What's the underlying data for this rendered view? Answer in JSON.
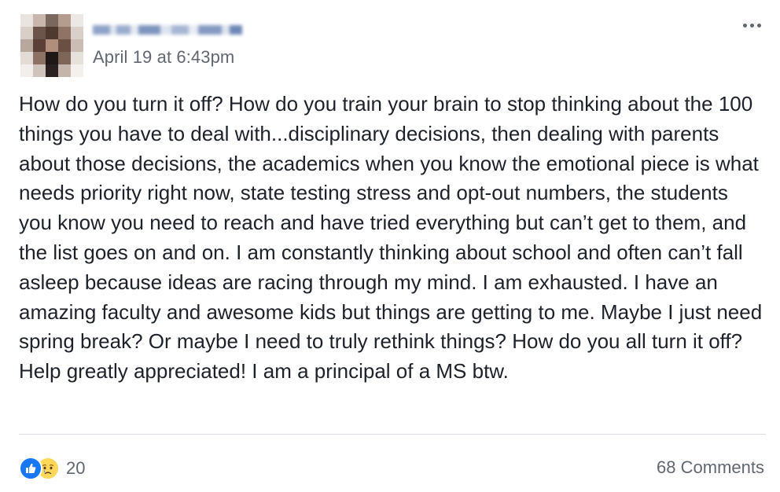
{
  "post": {
    "timestamp": "April 19 at 6:43pm",
    "body": "How do you turn it off? How do you train your brain to stop thinking about the 100 things you have to deal with...disciplinary decisions, then dealing with parents about those decisions, the academics when you know the emotional piece is what needs priority right now, state testing stress and opt-out numbers, the students you know you need to reach and have tried everything but can’t get to them, and the list goes on and on. I am constantly thinking about school and often can’t fall asleep because ideas are racing through my mind. I am exhausted. I have an amazing faculty and awesome kids but things are getting to me. Maybe I just need spring break? Or maybe I need to truly rethink things? How do you all turn it off? Help greatly appreciated! I am a principal of a MS btw."
  },
  "footer": {
    "reaction_count": "20",
    "comments_label": "68 Comments"
  },
  "icons": {
    "avatar": "avatar-image",
    "more_options": "more-options-icon",
    "like_reaction": "like-icon",
    "sad_reaction": "sad-icon"
  },
  "colors": {
    "text": "#1d2129",
    "secondary_text": "#616770",
    "like_blue": "#1877f2",
    "sad_yellow": "#ffd75a",
    "divider": "#dadde1"
  }
}
